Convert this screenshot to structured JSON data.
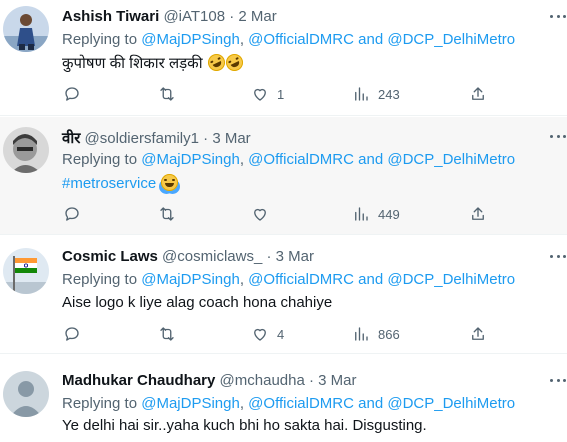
{
  "tweets": [
    {
      "name": "Ashish Tiwari",
      "handle": "@iAT108",
      "date": "2 Mar",
      "reply_prefix": "Replying to ",
      "reply_mention1": "@MajDPSingh",
      "reply_sep": ", ",
      "reply_mention2": "@OfficialDMRC",
      "reply_and": " and ",
      "reply_mention3": "@DCP_DelhiMetro",
      "body": "कुपोषण की शिकार लड़की",
      "body_emoji": [
        "rofl-face-icon",
        "rofl-face-icon"
      ],
      "likes": "1",
      "views": "243"
    },
    {
      "name": "वीर",
      "handle": "@soldiersfamily1",
      "date": "3 Mar",
      "reply_prefix": "Replying to ",
      "reply_mention1": "@MajDPSingh",
      "reply_sep": ", ",
      "reply_mention2": "@OfficialDMRC",
      "reply_and": " and ",
      "reply_mention3": "@DCP_DelhiMetro",
      "body": "#metroservice",
      "body_emoji": [
        "tears-of-joy-icon"
      ],
      "likes": "",
      "views": "449"
    },
    {
      "name": "Cosmic Laws",
      "handle": "@cosmiclaws_",
      "date": "3 Mar",
      "reply_prefix": "Replying to ",
      "reply_mention1": "@MajDPSingh",
      "reply_sep": ", ",
      "reply_mention2": "@OfficialDMRC",
      "reply_and": " and ",
      "reply_mention3": "@DCP_DelhiMetro",
      "body": "Aise logo k liye alag coach hona chahiye",
      "likes": "4",
      "views": "866"
    },
    {
      "name": "Madhukar Chaudhary",
      "handle": "@mchaudha",
      "date": "3 Mar",
      "reply_prefix": "Replying to ",
      "reply_mention1": "@MajDPSingh",
      "reply_sep": ", ",
      "reply_mention2": "@OfficialDMRC",
      "reply_and": " and ",
      "reply_mention3": "@DCP_DelhiMetro",
      "body": "Ye delhi hai sir..yaha kuch bhi ho sakta hai. Disgusting."
    }
  ],
  "separator": "·",
  "colors": {
    "link": "#1d9bf0",
    "secondary": "#536471",
    "hover_bg": "#f7f7f7"
  }
}
